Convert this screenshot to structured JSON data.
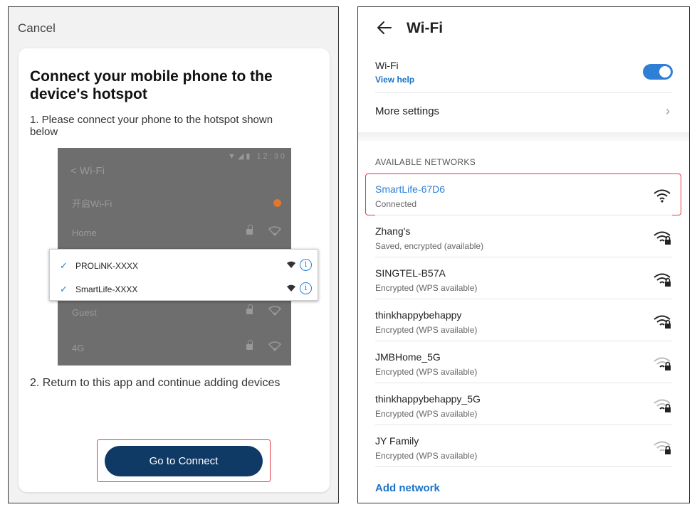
{
  "left": {
    "cancel_label": "Cancel",
    "title": "Connect your mobile phone to the device's hotspot",
    "step1": "1. Please connect your phone to the hotspot shown below",
    "step2": "2. Return to this app and continue adding devices",
    "phone_screenshot": {
      "status_time": "12:30",
      "back_label": "< Wi-Fi",
      "wifi_toggle_label": "开启Wi-Fi",
      "networks_bg": [
        "Home",
        "Guest",
        "4G"
      ],
      "popup_networks": [
        "PROLiNK-XXXX",
        "SmartLife-XXXX"
      ]
    },
    "go_button_label": "Go to Connect"
  },
  "right": {
    "title": "Wi-Fi",
    "wifi_label": "Wi-Fi",
    "view_help": "View help",
    "wifi_enabled": true,
    "more_settings": "More settings",
    "available_title": "AVAILABLE NETWORKS",
    "networks": [
      {
        "name": "SmartLife-67D6",
        "status": "Connected",
        "locked": false,
        "strength": "strong"
      },
      {
        "name": "Zhang's",
        "status": "Saved, encrypted (available)",
        "locked": true,
        "strength": "strong"
      },
      {
        "name": "SINGTEL-B57A",
        "status": "Encrypted (WPS available)",
        "locked": true,
        "strength": "strong"
      },
      {
        "name": "thinkhappybehappy",
        "status": "Encrypted (WPS available)",
        "locked": true,
        "strength": "strong"
      },
      {
        "name": "JMBHome_5G",
        "status": "Encrypted (WPS available)",
        "locked": true,
        "strength": "weak"
      },
      {
        "name": "thinkhappybehappy_5G",
        "status": "Encrypted (WPS available)",
        "locked": true,
        "strength": "weak"
      },
      {
        "name": "JY Family",
        "status": "Encrypted (WPS available)",
        "locked": true,
        "strength": "weak"
      }
    ],
    "add_network": "Add network"
  },
  "colors": {
    "accent_blue": "#2f7fd6",
    "button_navy": "#103a66",
    "highlight_red": "#e0393e",
    "toggle_orange": "#e0762f"
  }
}
